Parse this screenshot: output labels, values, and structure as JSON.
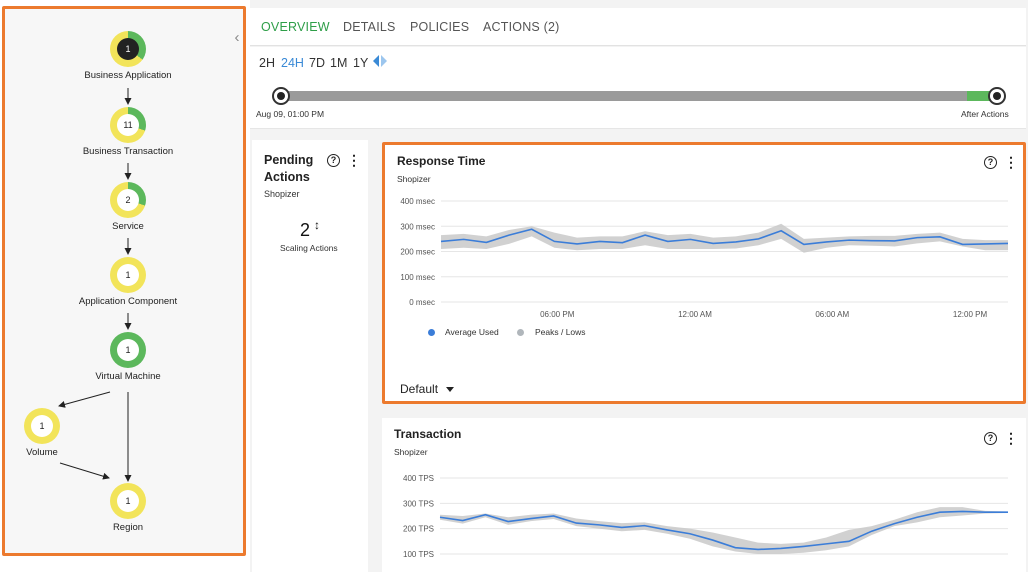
{
  "topology": {
    "nodes": [
      {
        "id": "business-application",
        "label": "Business Application",
        "count": "1",
        "style": "dark",
        "green_fraction": 0.35
      },
      {
        "id": "business-transaction",
        "label": "Business Transaction",
        "count": "11",
        "style": "light",
        "green_fraction": 0.3
      },
      {
        "id": "service",
        "label": "Service",
        "count": "2",
        "style": "light",
        "green_fraction": 0.3
      },
      {
        "id": "application-component",
        "label": "Application Component",
        "count": "1",
        "style": "light",
        "green_fraction": 0
      },
      {
        "id": "virtual-machine",
        "label": "Virtual Machine",
        "count": "1",
        "style": "light",
        "green_fraction": 1
      },
      {
        "id": "volume",
        "label": "Volume",
        "count": "1",
        "style": "light",
        "green_fraction": 0
      },
      {
        "id": "region",
        "label": "Region",
        "count": "1",
        "style": "light",
        "green_fraction": 0
      }
    ],
    "collapse_icon": "chevron-left-icon"
  },
  "tabs": [
    {
      "label": "OVERVIEW",
      "active": true
    },
    {
      "label": "DETAILS",
      "active": false
    },
    {
      "label": "POLICIES",
      "active": false
    },
    {
      "label": "ACTIONS (2)",
      "active": false
    }
  ],
  "time_range": {
    "options": [
      "2H",
      "24H",
      "7D",
      "1M",
      "1Y"
    ],
    "selected": "24H",
    "start_label": "Aug 09, 01:00 PM",
    "end_label": "After Actions"
  },
  "pending_actions": {
    "title": "Pending Actions",
    "subtitle": "Shopizer",
    "count": "2",
    "caption": "Scaling Actions"
  },
  "colors": {
    "accent_green": "#2e9e48",
    "ring_yellow": "#f2e45a",
    "ring_green": "#5cb85c",
    "line_blue": "#3b7dd8",
    "band_gray": "#c9c9c9",
    "highlight_orange": "#ec7a2e"
  },
  "chart_data": [
    {
      "type": "line",
      "title": "Response Time",
      "subtitle": "Shopizer",
      "y_ticks": [
        "400 msec",
        "300 msec",
        "200 msec",
        "100 msec",
        "0 msec"
      ],
      "x_ticks": [
        "06:00 PM",
        "12:00 AM",
        "06:00 AM",
        "12:00 PM"
      ],
      "ylim": [
        0,
        400
      ],
      "series": [
        {
          "name": "Average Used",
          "values": [
            240,
            248,
            236,
            265,
            288,
            240,
            230,
            240,
            235,
            265,
            240,
            248,
            232,
            238,
            250,
            282,
            228,
            238,
            245,
            243,
            242,
            255,
            258,
            228,
            230,
            232
          ]
        },
        {
          "name": "Peaks / Lows",
          "upper": [
            265,
            270,
            260,
            285,
            300,
            275,
            255,
            260,
            260,
            280,
            265,
            270,
            255,
            260,
            275,
            310,
            250,
            255,
            260,
            262,
            262,
            270,
            275,
            250,
            245,
            245
          ],
          "lower": [
            210,
            215,
            210,
            230,
            260,
            215,
            205,
            210,
            210,
            225,
            210,
            210,
            210,
            212,
            225,
            250,
            195,
            215,
            225,
            223,
            220,
            232,
            240,
            220,
            205,
            205
          ]
        }
      ],
      "legend": [
        "Average Used",
        "Peaks / Lows"
      ],
      "dropdown": "Default"
    },
    {
      "type": "line",
      "title": "Transaction",
      "subtitle": "Shopizer",
      "y_ticks": [
        "400 TPS",
        "300 TPS",
        "200 TPS",
        "100 TPS"
      ],
      "ylim": [
        100,
        400
      ],
      "series": [
        {
          "name": "Average Used",
          "values": [
            245,
            232,
            255,
            228,
            240,
            250,
            222,
            215,
            205,
            212,
            195,
            180,
            155,
            125,
            118,
            122,
            130,
            140,
            150,
            190,
            220,
            245,
            265,
            268,
            265,
            265
          ]
        },
        {
          "name": "Peaks / Lows",
          "upper": [
            255,
            250,
            260,
            245,
            255,
            260,
            240,
            230,
            222,
            225,
            210,
            200,
            185,
            165,
            145,
            140,
            145,
            165,
            195,
            210,
            235,
            265,
            285,
            285,
            270,
            268
          ],
          "lower": [
            235,
            220,
            245,
            215,
            230,
            238,
            210,
            200,
            190,
            195,
            180,
            160,
            130,
            110,
            100,
            100,
            105,
            115,
            130,
            175,
            210,
            225,
            245,
            252,
            260,
            262
          ]
        }
      ]
    }
  ]
}
